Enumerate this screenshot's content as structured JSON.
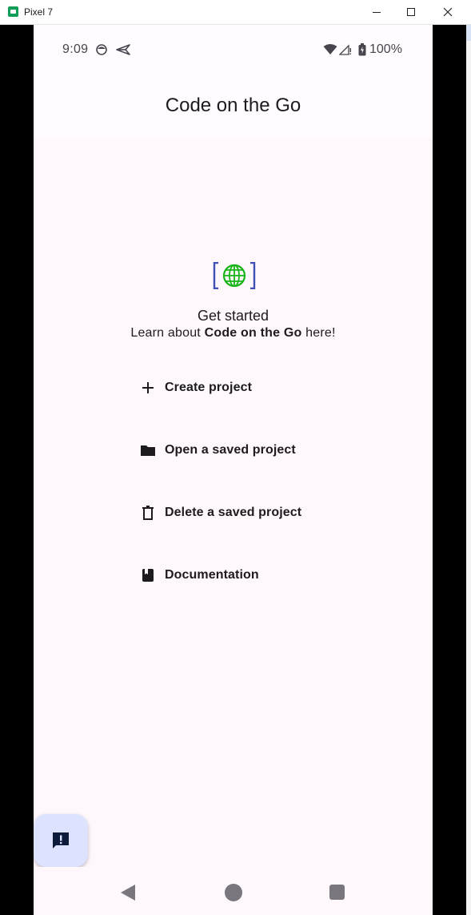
{
  "window": {
    "title": "Pixel 7"
  },
  "status_bar": {
    "time": "9:09",
    "battery_pct": "100%"
  },
  "app_bar": {
    "title": "Code on the Go"
  },
  "hero": {
    "heading": "Get started",
    "learn_prefix": "Learn about ",
    "learn_bold": "Code on the Go",
    "learn_suffix": " here!"
  },
  "actions": [
    {
      "label": "Create project",
      "icon": "plus-icon"
    },
    {
      "label": "Open a saved project",
      "icon": "folder-icon"
    },
    {
      "label": "Delete a saved project",
      "icon": "trash-icon"
    },
    {
      "label": "Documentation",
      "icon": "book-icon"
    }
  ],
  "fab": {
    "icon": "feedback-icon"
  },
  "colors": {
    "background": "#fef7fc",
    "fab": "#dde3ff",
    "globe": "#17b417",
    "bracket": "#3f51b5"
  }
}
